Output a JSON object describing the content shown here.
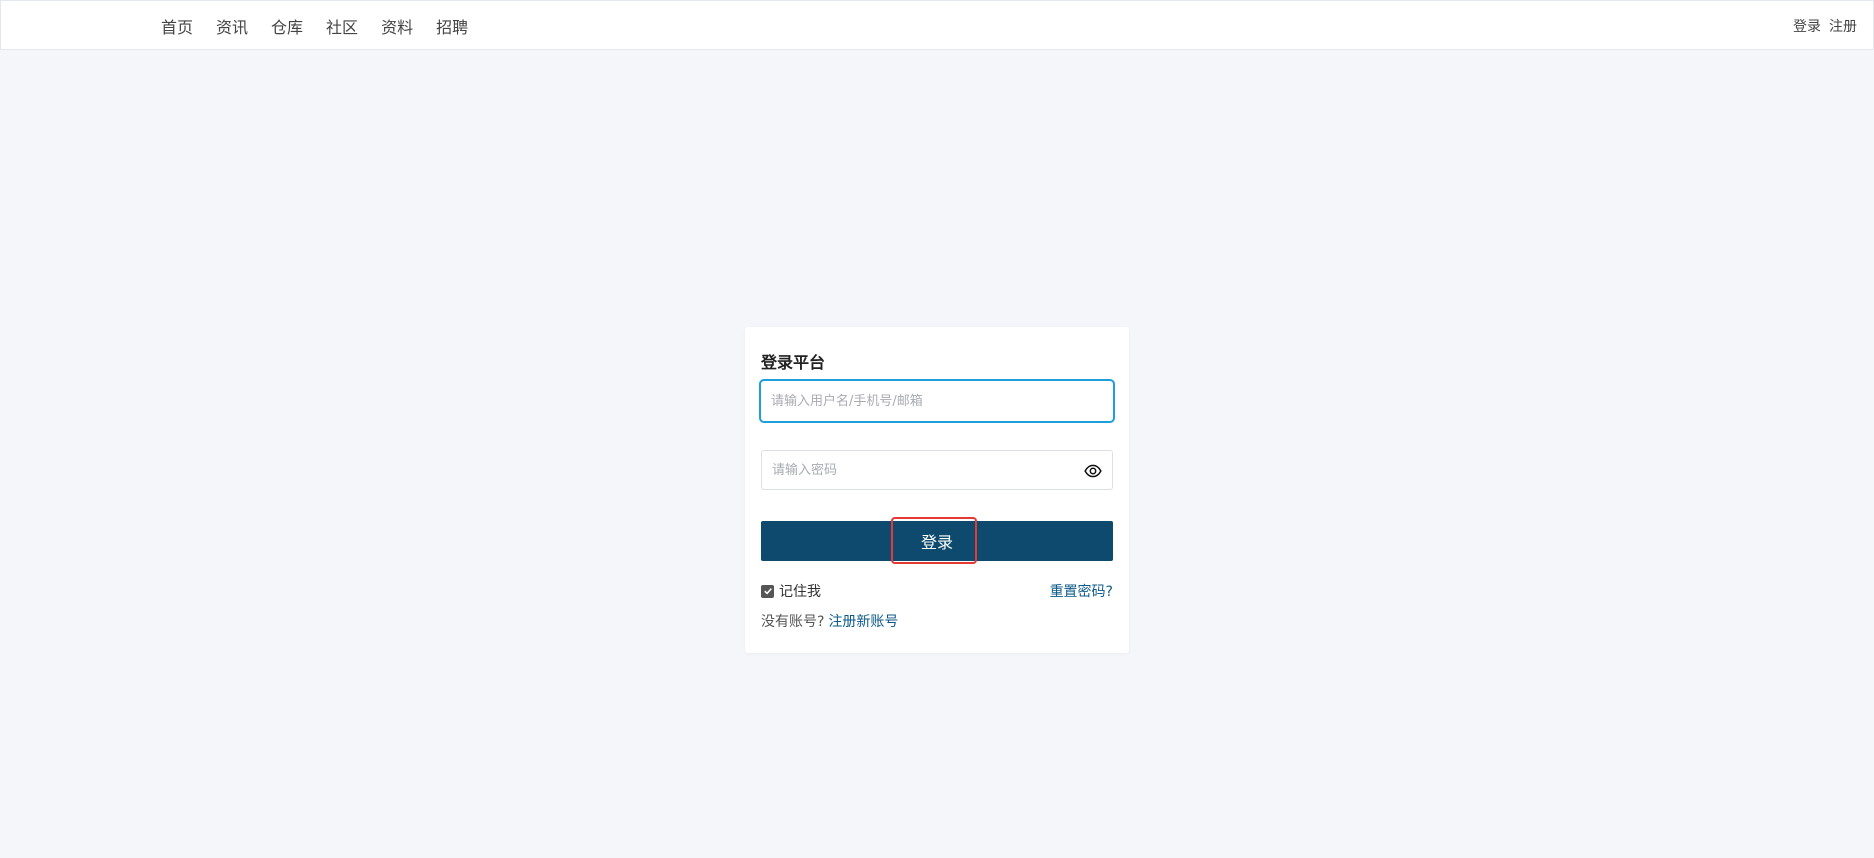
{
  "nav": {
    "items": [
      {
        "label": "首页"
      },
      {
        "label": "资讯"
      },
      {
        "label": "仓库"
      },
      {
        "label": "社区"
      },
      {
        "label": "资料"
      },
      {
        "label": "招聘"
      }
    ],
    "login_label": "登录",
    "register_label": "注册"
  },
  "login": {
    "title": "登录平台",
    "username_placeholder": "请输入用户名/手机号/邮箱",
    "username_value": "",
    "password_placeholder": "请输入密码",
    "password_value": "",
    "password_toggle_icon": "eye-icon",
    "submit_label": "登录",
    "remember_label": "记住我",
    "remember_checked": true,
    "reset_label": "重置密码?",
    "no_account_label": "没有账号?",
    "register_label": "注册新账号"
  },
  "colors": {
    "page_background": "#f4f6fa",
    "primary_button": "#0d4a6e",
    "link": "#0d5a8a",
    "focus_border": "#1e9fdb",
    "highlight": "#e53935"
  }
}
